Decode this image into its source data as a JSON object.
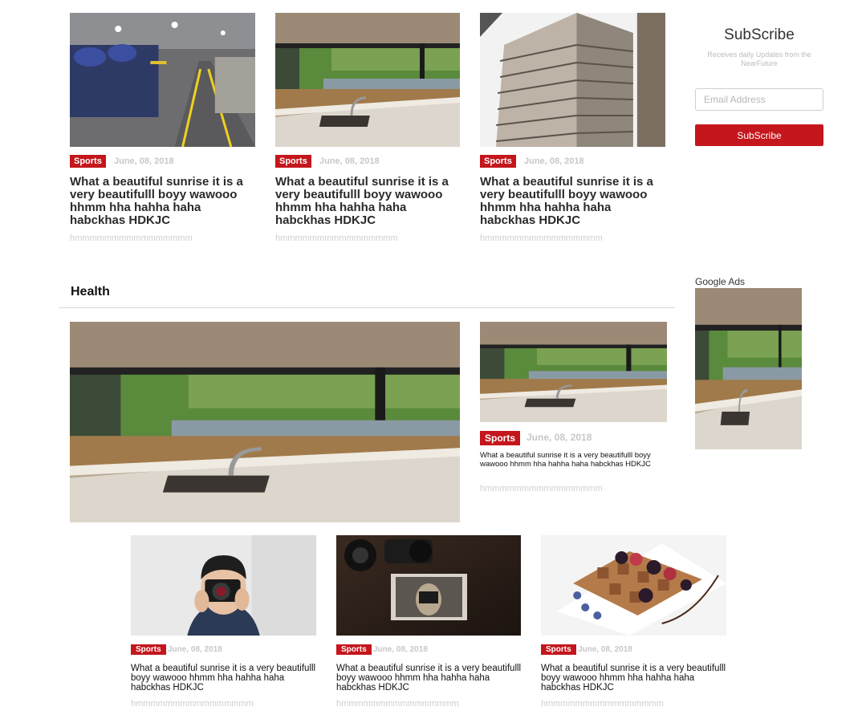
{
  "top_posts": [
    {
      "image": "factory-floor-photo",
      "category": "Sports",
      "date": "June, 08, 2018",
      "title": "What a beautiful sunrise it is a very beautifulll boyy wawooo hhmm hha hahha haha habckhas HDKJC",
      "excerpt": "hmmmmmmmmmmmmmmmm"
    },
    {
      "image": "kitchen-sink-photo",
      "category": "Sports",
      "date": "June, 08, 2018",
      "title": "What a beautiful sunrise it is a very beautifulll boyy wawooo hhmm hha hahha haha habckhas HDKJC",
      "excerpt": "hmmmmmmmmmmmmmmmm"
    },
    {
      "image": "skyscraper-photo",
      "category": "Sports",
      "date": "June, 08, 2018",
      "title": "What a beautiful sunrise it is a very beautifulll boyy wawooo hhmm hha hahha haha habckhas HDKJC",
      "excerpt": "hmmmmmmmmmmmmmmmm"
    }
  ],
  "subscribe": {
    "title": "SubScribe",
    "description": "Receives daily Updates from the NearFuture",
    "email_placeholder": "Email Address",
    "button_label": "SubScribe"
  },
  "ads": {
    "label": "Google Ads",
    "image": "kitchen-sink-photo"
  },
  "health": {
    "section_title": "Health",
    "featured": {
      "image": "kitchen-sink-photo"
    },
    "side_post": {
      "image": "kitchen-sink-photo",
      "category": "Sports",
      "date": "June, 08, 2018",
      "title": "What a beautiful sunrise it is a very beautifulll boyy wawooo hhmm hha hahha haha habckhas HDKJC",
      "excerpt": "hmmmmmmmmmmmmmmmm"
    },
    "bottom_posts": [
      {
        "image": "photographer-photo",
        "category": "Sports",
        "date": "June, 08, 2018",
        "title": "What a beautiful sunrise it is a very beautifulll boyy wawooo hhmm hha hahha haha habckhas HDKJC",
        "excerpt": "hmmmmmmmmmmmmmmmm"
      },
      {
        "image": "camera-desk-photo",
        "category": "Sports",
        "date": "June, 08, 2018",
        "title": "What a beautiful sunrise it is a very beautifulll boyy wawooo hhmm hha hahha haha habckhas HDKJC",
        "excerpt": "hmmmmmmmmmmmmmmmm"
      },
      {
        "image": "waffles-berries-photo",
        "category": "Sports",
        "date": "June, 08, 2018",
        "title": "What a beautiful sunrise it is a very beautifulll boyy wawooo hhmm hha hahha haha habckhas HDKJC",
        "excerpt": "hmmmmmmmmmmmmmmmm"
      }
    ]
  },
  "colors": {
    "accent": "#c4161c",
    "muted_text": "#c7c7c7",
    "rule": "#dcdcdc"
  }
}
